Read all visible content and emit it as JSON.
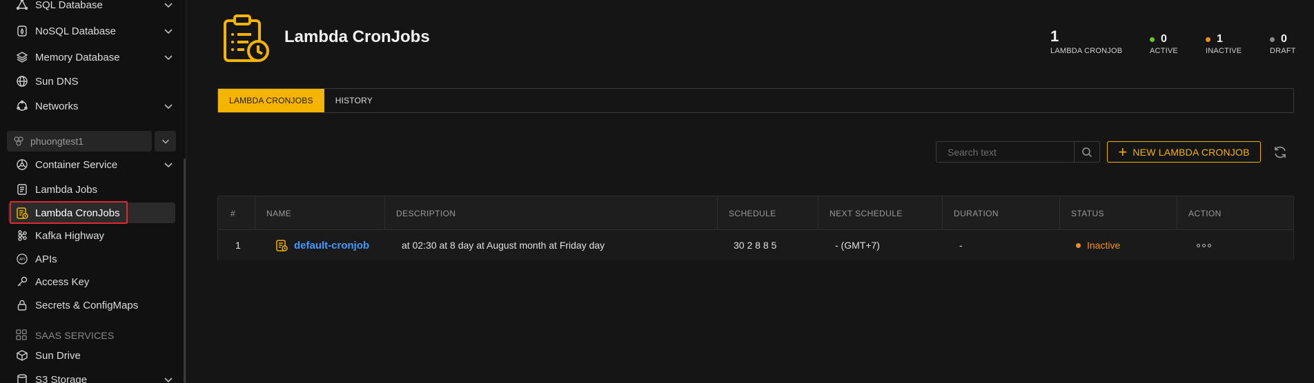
{
  "sidebar": {
    "items": [
      {
        "label": "SQL Database",
        "icon": "sql-database-icon",
        "chevron": true
      },
      {
        "label": "NoSQL Database",
        "icon": "nosql-database-icon",
        "chevron": true
      },
      {
        "label": "Memory Database",
        "icon": "memory-database-icon",
        "chevron": true
      },
      {
        "label": "Sun DNS",
        "icon": "globe-icon",
        "chevron": false
      },
      {
        "label": "Networks",
        "icon": "network-icon",
        "chevron": true
      }
    ],
    "project": {
      "label": "phuongtest1",
      "icon": "project-icon"
    },
    "project_items": [
      {
        "label": "Container Service",
        "icon": "container-icon",
        "chevron": true
      },
      {
        "label": "Lambda Jobs",
        "icon": "lambda-jobs-icon",
        "chevron": false
      },
      {
        "label": "Lambda CronJobs",
        "icon": "lambda-cronjobs-icon",
        "chevron": false,
        "active": true
      },
      {
        "label": "Kafka Highway",
        "icon": "kafka-icon",
        "chevron": false
      },
      {
        "label": "APIs",
        "icon": "api-icon",
        "chevron": false
      },
      {
        "label": "Access Key",
        "icon": "key-icon",
        "chevron": false
      },
      {
        "label": "Secrets & ConfigMaps",
        "icon": "lock-icon",
        "chevron": false
      }
    ],
    "saas_section": "SAAS SERVICES",
    "saas_items": [
      {
        "label": "Sun Drive",
        "icon": "box-icon",
        "chevron": false
      },
      {
        "label": "S3 Storage",
        "icon": "storage-icon",
        "chevron": true
      }
    ]
  },
  "header": {
    "title": "Lambda CronJobs",
    "icon": "clipboard-clock-icon",
    "stats": [
      {
        "value": "1",
        "label": "LAMBDA CRONJOB"
      },
      {
        "value": "0",
        "label": "ACTIVE",
        "color": "#6cc425"
      },
      {
        "value": "1",
        "label": "INACTIVE",
        "color": "#f0921a"
      },
      {
        "value": "0",
        "label": "DRAFT",
        "color": "#8a8a8a"
      }
    ]
  },
  "tabs": [
    {
      "label": "LAMBDA CRONJOBS",
      "active": true
    },
    {
      "label": "HISTORY",
      "active": false
    }
  ],
  "toolbar": {
    "search_placeholder": "Search text",
    "new_label": "NEW LAMBDA CRONJOB",
    "accent": "#f5b400"
  },
  "table": {
    "columns": [
      "#",
      "NAME",
      "DESCRIPTION",
      "SCHEDULE",
      "NEXT SCHEDULE",
      "DURATION",
      "STATUS",
      "ACTION"
    ],
    "rows": [
      {
        "index": "1",
        "name": "default-cronjob",
        "description": "at 02:30 at 8 day at August month at Friday day",
        "schedule": "30 2 8 8 5",
        "next_schedule": "- (GMT+7)",
        "duration": "-",
        "status": "Inactive"
      }
    ]
  }
}
